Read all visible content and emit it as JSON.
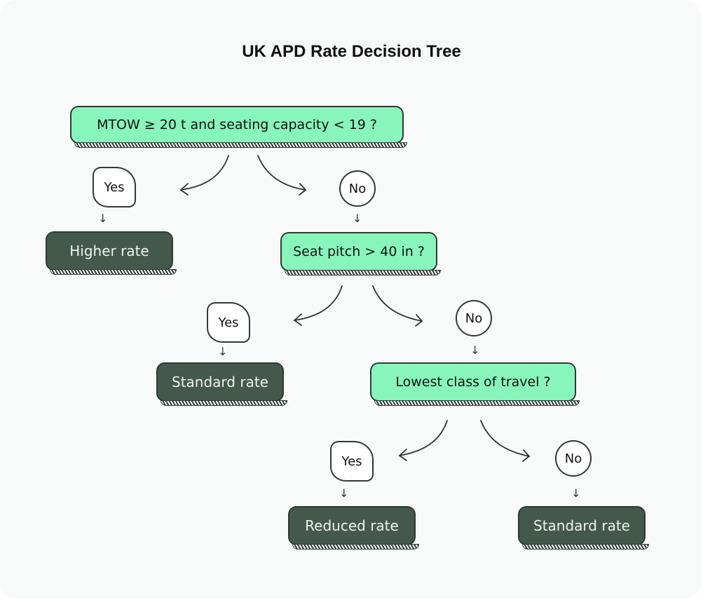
{
  "title": "UK APD Rate Decision Tree",
  "nodes": {
    "q1": "MTOW ≥ 20 t and seating capacity < 19 ?",
    "q2": "Seat pitch > 40 in ?",
    "q3": "Lowest class of travel ?",
    "r1": "Higher rate",
    "r2": "Standard rate",
    "r3": "Reduced rate",
    "r4": "Standard rate"
  },
  "branches": {
    "yes": "Yes",
    "no": "No"
  },
  "colors": {
    "question_fill": "#88f5bb",
    "result_fill": "#42594b",
    "outline": "#2f3a35",
    "background": "#f8fafa"
  }
}
